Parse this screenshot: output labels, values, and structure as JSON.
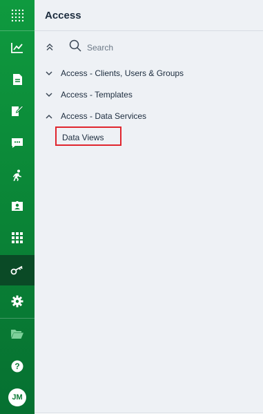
{
  "rail": {
    "items": [
      {
        "icon": "apps-grid-icon"
      },
      {
        "icon": "chart-line-icon"
      },
      {
        "icon": "document-icon"
      },
      {
        "icon": "edit-document-icon"
      },
      {
        "icon": "chat-icon"
      },
      {
        "icon": "running-person-icon"
      },
      {
        "icon": "contact-card-icon"
      },
      {
        "icon": "dashboard-grid-icon"
      },
      {
        "icon": "key-icon",
        "active": true
      },
      {
        "icon": "gear-icon"
      },
      {
        "icon": "folder-open-icon"
      },
      {
        "icon": "help-icon"
      }
    ],
    "avatar_initials": "JM"
  },
  "panel": {
    "title": "Access",
    "search": {
      "placeholder": "Search",
      "value": ""
    },
    "groups": [
      {
        "label": "Access - Clients, Users & Groups",
        "expanded": false
      },
      {
        "label": "Access - Templates",
        "expanded": false
      },
      {
        "label": "Access - Data Services",
        "expanded": true,
        "children": [
          "Data Views"
        ]
      }
    ]
  },
  "colors": {
    "rail_green": "#0a8336",
    "rail_active": "#0a4a26",
    "panel_bg": "#eef1f5",
    "highlight": "#e0242c"
  }
}
